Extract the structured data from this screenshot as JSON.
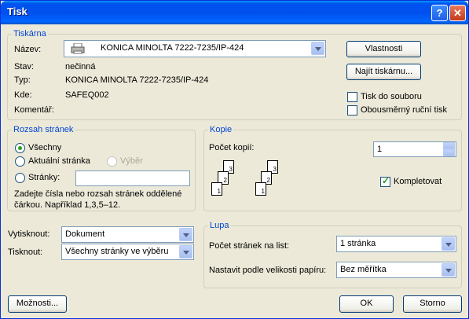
{
  "window": {
    "title": "Tisk",
    "help_glyph": "?",
    "close_glyph": "✕"
  },
  "printer": {
    "group_label": "Tiskárna",
    "name_label": "Název:",
    "name_value": "KONICA MINOLTA 7222-7235/IP-424",
    "status_label": "Stav:",
    "status_value": "nečinná",
    "type_label": "Typ:",
    "type_value": "KONICA MINOLTA 7222-7235/IP-424",
    "where_label": "Kde:",
    "where_value": "SAFEQ002",
    "comment_label": "Komentář:",
    "properties_button": "Vlastnosti",
    "find_printer_button": "Najít tiskárnu...",
    "print_to_file_label": "Tisk do souboru",
    "print_to_file_checked": false,
    "manual_duplex_label": "Obousměrný ruční tisk",
    "manual_duplex_checked": false
  },
  "page_range": {
    "group_label": "Rozsah stránek",
    "all_label": "Všechny",
    "current_label": "Aktuální stránka",
    "selection_label": "Výběr",
    "pages_label": "Stránky:",
    "pages_value": "",
    "selected": "all",
    "hint": "Zadejte čísla nebo rozsah stránek oddělené čárkou. Například 1,3,5–12."
  },
  "copies": {
    "group_label": "Kopie",
    "count_label": "Počet kopií:",
    "count_value": "1",
    "collate_label": "Kompletovat",
    "collate_checked": true,
    "page_numbers": [
      "1",
      "2",
      "3"
    ]
  },
  "print_what": {
    "print_what_label": "Vytisknout:",
    "print_what_value": "Dokument",
    "print_label": "Tisknout:",
    "print_value": "Všechny stránky ve výběru"
  },
  "zoom": {
    "group_label": "Lupa",
    "pages_per_sheet_label": "Počet stránek na list:",
    "pages_per_sheet_value": "1 stránka",
    "scale_label": "Nastavit podle velikosti papíru:",
    "scale_value": "Bez měřítka"
  },
  "footer": {
    "options_button": "Možnosti...",
    "ok_button": "OK",
    "cancel_button": "Storno"
  },
  "colors": {
    "title_bar": "#0054e3",
    "group_label": "#0046d5",
    "window_bg": "#ece9d8",
    "check_mark": "#21a121"
  }
}
